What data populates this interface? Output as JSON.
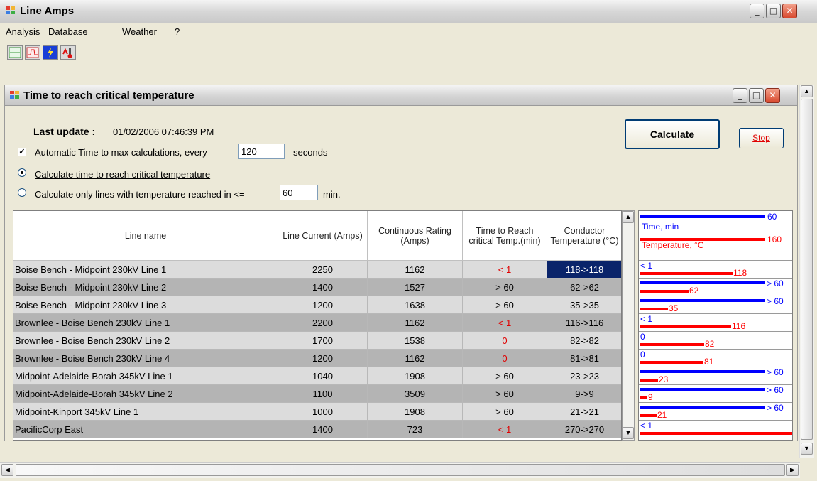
{
  "window": {
    "title": "Line Amps"
  },
  "menu": [
    {
      "label": "Analysis"
    },
    {
      "label": "Database"
    },
    {
      "label": "Weather"
    },
    {
      "label": "?"
    }
  ],
  "toolbar": {
    "icons": [
      "line-chart-icon",
      "wave-chart-icon",
      "lightning-icon",
      "thermometer-icon"
    ]
  },
  "child": {
    "title": "Time to reach critical temperature",
    "last_update_label": "Last update :",
    "last_update_value": "01/02/2006 07:46:39 PM",
    "auto_calc_label": "Automatic Time to max calculations, every",
    "auto_calc_value": "120",
    "auto_calc_unit": "seconds",
    "auto_calc_checked": true,
    "radio_all_label": "Calculate time to reach critical temperature",
    "radio_only_label": "Calculate only lines with temperature reached in <=",
    "radio_only_value": "60",
    "radio_only_unit": "min.",
    "calculate_label": "Calculate",
    "stop_label": "Stop"
  },
  "grid": {
    "headers": [
      "Line name",
      "Line Current (Amps)",
      "Continuous Rating (Amps)",
      "Time to Reach critical Temp.(min)",
      "Conductor Temperature (°C)"
    ],
    "rows": [
      {
        "name": "Boise Bench - Midpoint 230kV Line 1",
        "current": "2250",
        "rating": "1162",
        "time": "< 1",
        "temp": "118->118",
        "time_red": true
      },
      {
        "name": "Boise Bench - Midpoint 230kV Line 2",
        "current": "1400",
        "rating": "1527",
        "time": "> 60",
        "temp": "62->62",
        "time_red": false
      },
      {
        "name": "Boise Bench - Midpoint 230kV Line 3",
        "current": "1200",
        "rating": "1638",
        "time": "> 60",
        "temp": "35->35",
        "time_red": false
      },
      {
        "name": "Brownlee - Boise Bench 230kV Line 1",
        "current": "2200",
        "rating": "1162",
        "time": "< 1",
        "temp": "116->116",
        "time_red": true
      },
      {
        "name": "Brownlee - Boise Bench 230kV Line 2",
        "current": "1700",
        "rating": "1538",
        "time": "0",
        "temp": "82->82",
        "time_red": true
      },
      {
        "name": "Brownlee - Boise Bench 230kV Line 4",
        "current": "1200",
        "rating": "1162",
        "time": "0",
        "temp": "81->81",
        "time_red": true
      },
      {
        "name": "Midpoint-Adelaide-Borah 345kV Line 1",
        "current": "1040",
        "rating": "1908",
        "time": "> 60",
        "temp": "23->23",
        "time_red": false
      },
      {
        "name": "Midpoint-Adelaide-Borah 345kV Line 2",
        "current": "1100",
        "rating": "3509",
        "time": "> 60",
        "temp": "9->9",
        "time_red": false
      },
      {
        "name": "Midpoint-Kinport 345kV Line 1",
        "current": "1000",
        "rating": "1908",
        "time": "> 60",
        "temp": "21->21",
        "time_red": false
      },
      {
        "name": "PacificCorp East",
        "current": "1400",
        "rating": "723",
        "time": "< 1",
        "temp": "270->270",
        "time_red": true
      }
    ]
  },
  "bars": {
    "legend_time_label": "Time, min",
    "legend_time_max": "60",
    "legend_temp_label": "Temperature, °C",
    "legend_temp_max": "160",
    "rows": [
      {
        "time_label": "< 1",
        "time_frac": 0.0,
        "temp_label": "118",
        "temp": 118
      },
      {
        "time_label": "> 60",
        "time_frac": 1.0,
        "temp_label": "62",
        "temp": 62
      },
      {
        "time_label": "> 60",
        "time_frac": 1.0,
        "temp_label": "35",
        "temp": 35
      },
      {
        "time_label": "< 1",
        "time_frac": 0.0,
        "temp_label": "116",
        "temp": 116
      },
      {
        "time_label": "0",
        "time_frac": 0.0,
        "temp_label": "82",
        "temp": 82
      },
      {
        "time_label": "0",
        "time_frac": 0.0,
        "temp_label": "81",
        "temp": 81
      },
      {
        "time_label": "> 60",
        "time_frac": 1.0,
        "temp_label": "23",
        "temp": 23
      },
      {
        "time_label": "> 60",
        "time_frac": 1.0,
        "temp_label": "9",
        "temp": 9
      },
      {
        "time_label": "> 60",
        "time_frac": 1.0,
        "temp_label": "21",
        "temp": 21
      },
      {
        "time_label": "< 1",
        "time_frac": 0.0,
        "temp_label": "",
        "temp": 270
      }
    ],
    "colors": {
      "time": "#0000ff",
      "temp": "#ff0000"
    }
  }
}
